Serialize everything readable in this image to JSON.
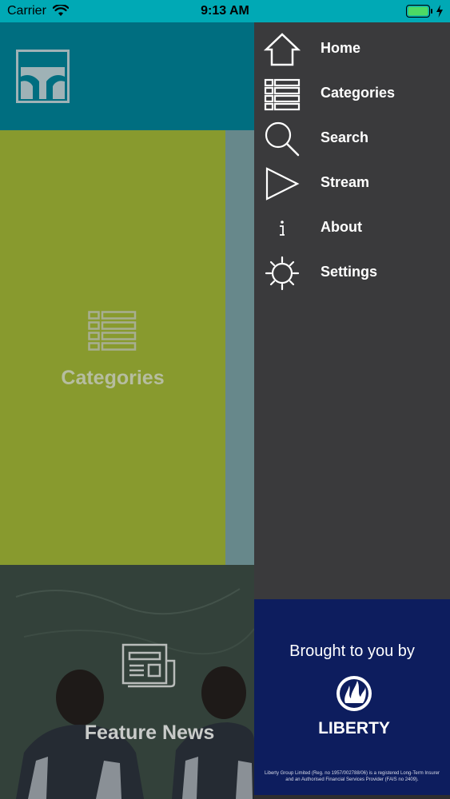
{
  "status_bar": {
    "carrier": "Carrier",
    "time": "9:13 AM",
    "background": "#00a9b5",
    "battery_color": "#4cd964"
  },
  "main": {
    "categories_tile": {
      "label": "Categories",
      "icon": "list-icon",
      "color": "#889a2e"
    },
    "feature_tile": {
      "label": "Feature News",
      "icon": "newspaper-icon"
    }
  },
  "menu": {
    "items": [
      {
        "label": "Home",
        "icon": "home-icon"
      },
      {
        "label": "Categories",
        "icon": "list-icon"
      },
      {
        "label": "Search",
        "icon": "search-icon"
      },
      {
        "label": "Stream",
        "icon": "play-icon"
      },
      {
        "label": "About",
        "icon": "info-icon"
      },
      {
        "label": "Settings",
        "icon": "gear-icon"
      }
    ],
    "background": "#3a3a3c"
  },
  "sponsor": {
    "heading": "Brought to you by",
    "brand": "LIBERTY",
    "disclaimer": "Liberty Group Limited (Reg. no 1957/002788/06) is a registered Long-Term Insurer and an Authorised Financial Services Provider (FAIS no 2409).",
    "background": "#0d1d5e"
  }
}
